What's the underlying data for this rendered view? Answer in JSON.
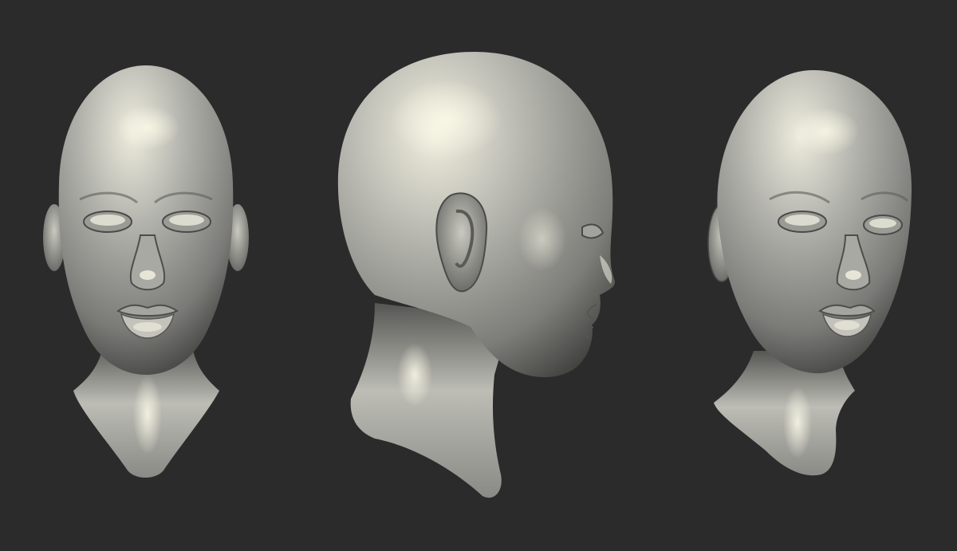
{
  "scene": {
    "background_color": "#2b2b2b",
    "material": {
      "base_color": "#8d8d8a",
      "highlight_color": "#ecebdc",
      "shadow_color": "#3a3a38"
    },
    "views": [
      {
        "view": "front"
      },
      {
        "view": "side-profile-right"
      },
      {
        "view": "three-quarter-right"
      }
    ]
  }
}
